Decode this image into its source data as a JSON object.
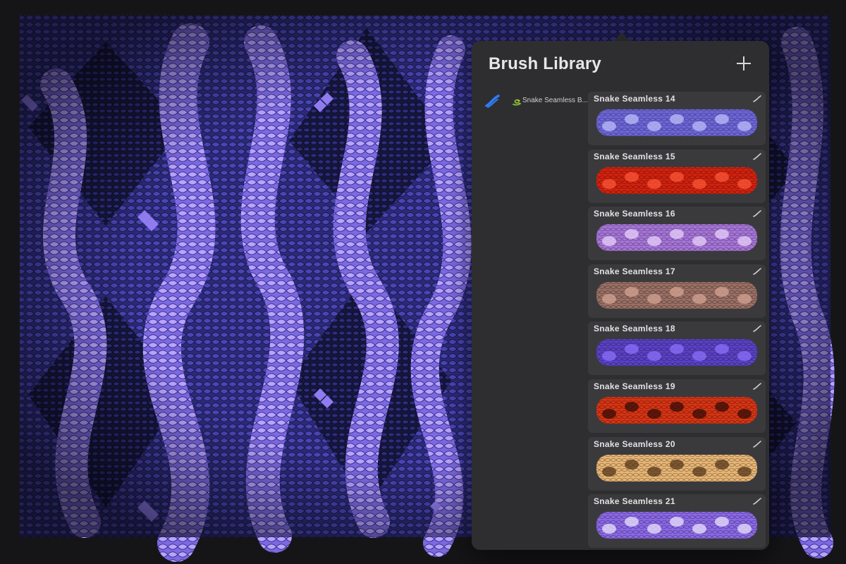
{
  "panel": {
    "title": "Brush Library",
    "add_icon": "plus-icon"
  },
  "brush_set": {
    "emoji": "snake-emoji",
    "label": "Snake Seamless B..."
  },
  "brushes": [
    {
      "name": "Snake Seamless  14",
      "color": "#6d66d8",
      "accent": "#c2c4ff"
    },
    {
      "name": "Snake Seamless  15",
      "color": "#d2220e",
      "accent": "#ff5a3c"
    },
    {
      "name": "Snake Seamless  16",
      "color": "#a675d8",
      "accent": "#f0d8ff"
    },
    {
      "name": "Snake Seamless  17",
      "color": "#9a6f64",
      "accent": "#d9a898"
    },
    {
      "name": "Snake Seamless  18",
      "color": "#5a41c4",
      "accent": "#8f74ff"
    },
    {
      "name": "Snake Seamless 19",
      "color": "#d63414",
      "accent": "#2a0a06"
    },
    {
      "name": "Snake Seamless 20",
      "color": "#e7b574",
      "accent": "#4b2d16"
    },
    {
      "name": "Snake Seamless 21",
      "color": "#8a68e6",
      "accent": "#f2ecff"
    }
  ],
  "colors": {
    "background": "#151518",
    "panel": "#2e2e30",
    "card": "#3a3a3d",
    "accent_blue": "#2f7bf6",
    "snake_light": "#a98cf5",
    "snake_dark": "#2a2a78"
  }
}
